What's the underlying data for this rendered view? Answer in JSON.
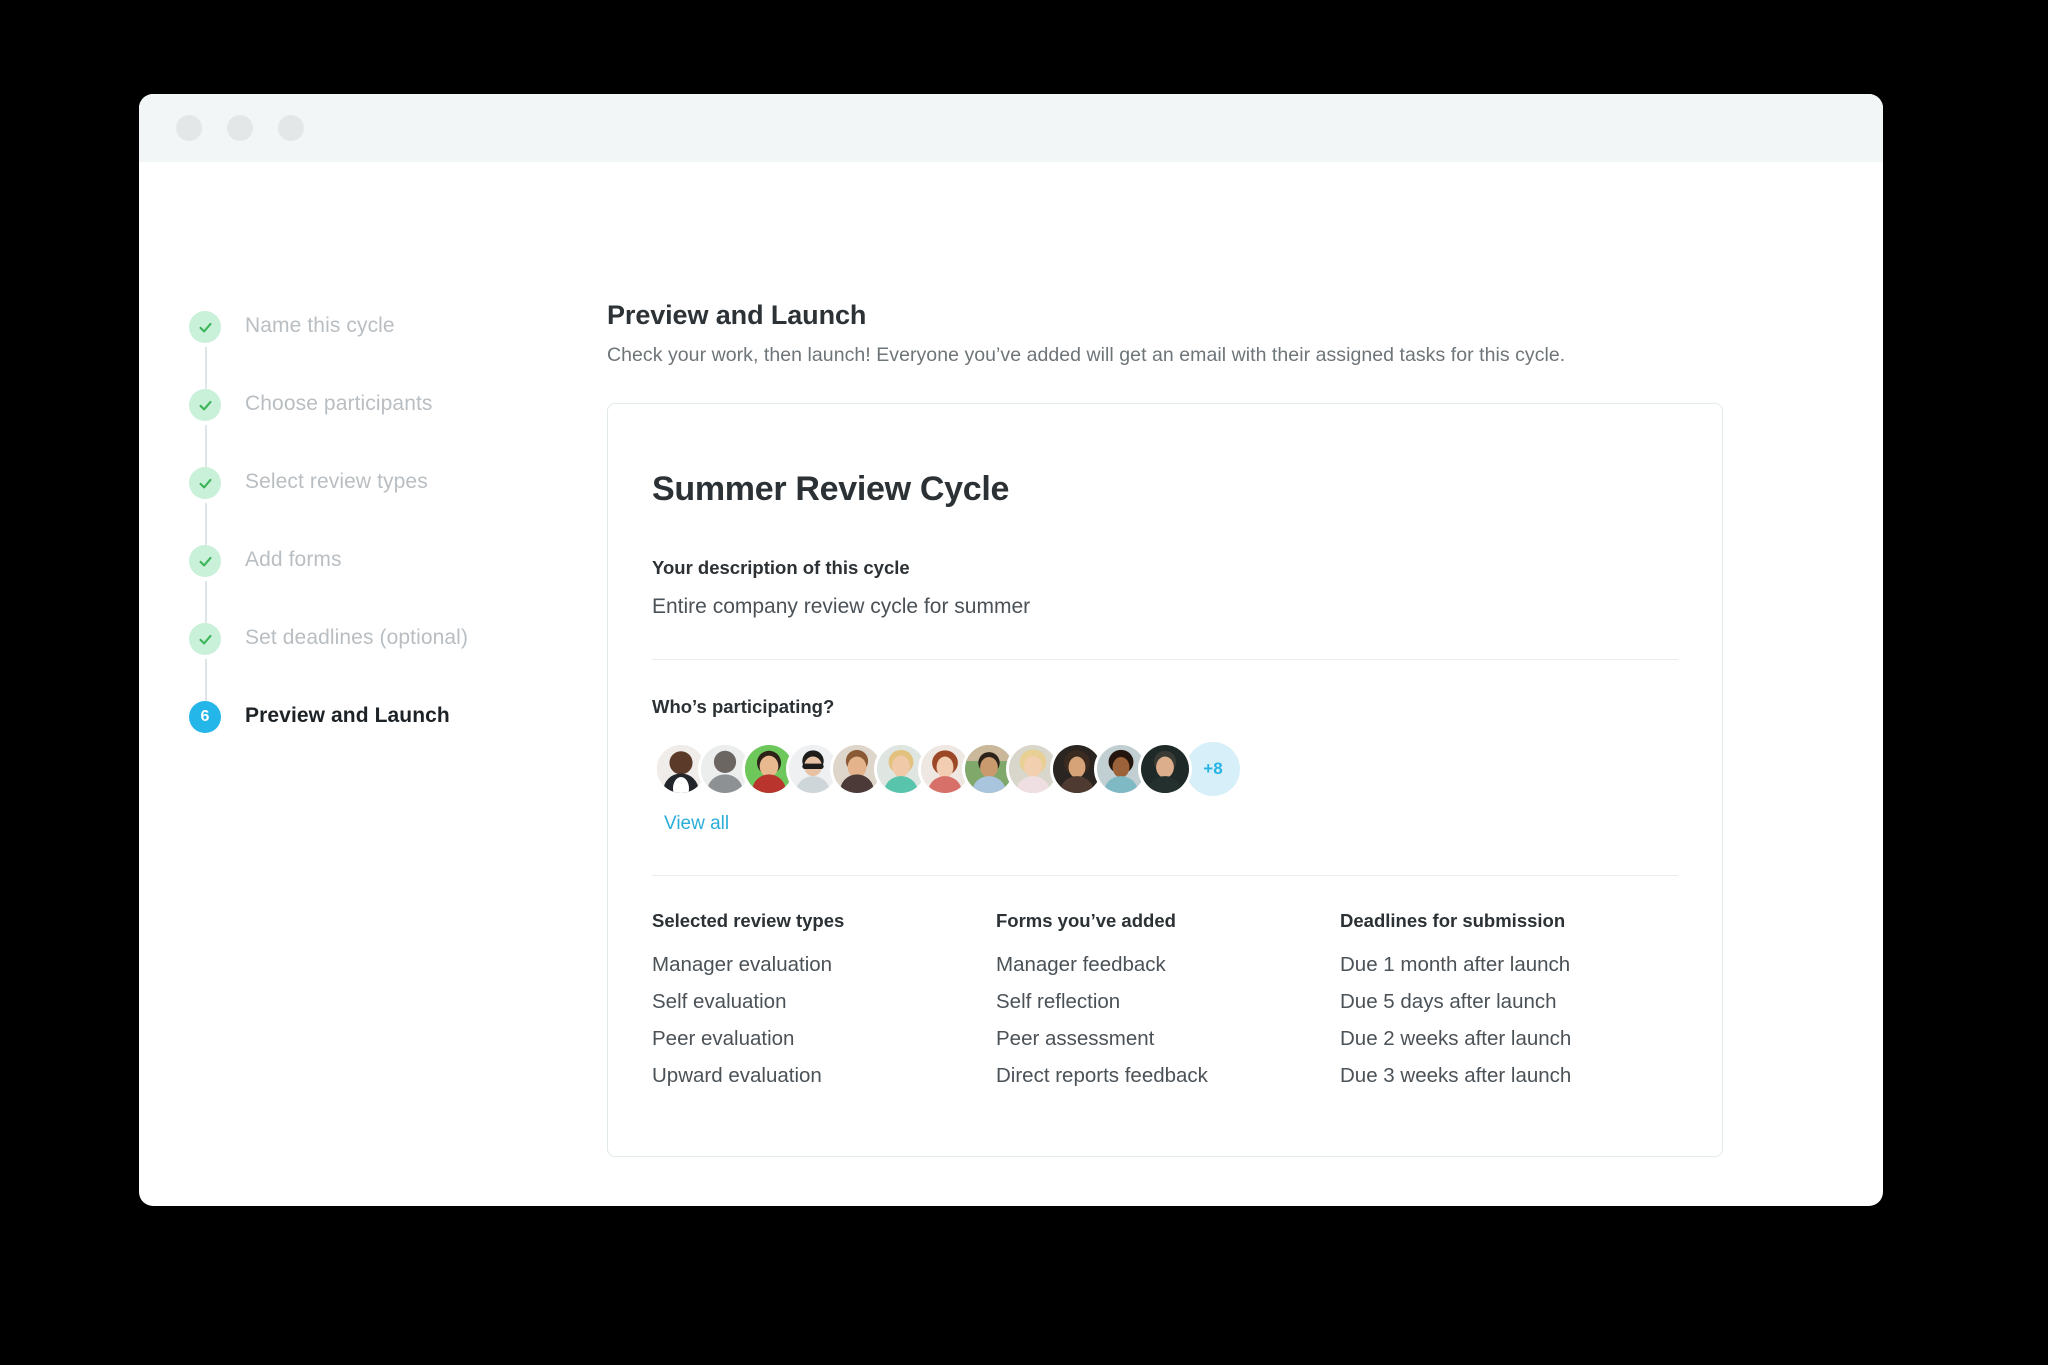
{
  "window": {
    "traffic_lights": [
      "close-dot",
      "minimize-dot",
      "maximize-dot"
    ]
  },
  "stepper": {
    "steps": [
      {
        "label": "Name this cycle",
        "state": "done",
        "marker": "check-icon"
      },
      {
        "label": "Choose participants",
        "state": "done",
        "marker": "check-icon"
      },
      {
        "label": "Select review types",
        "state": "done",
        "marker": "check-icon"
      },
      {
        "label": "Add forms",
        "state": "done",
        "marker": "check-icon"
      },
      {
        "label": "Set deadlines (optional)",
        "state": "done",
        "marker": "check-icon"
      },
      {
        "label": "Preview and Launch",
        "state": "active",
        "marker": "6"
      }
    ]
  },
  "header": {
    "title": "Preview and Launch",
    "subtitle": "Check your work, then launch! Everyone you’ve added will get an email with their assigned tasks for this cycle."
  },
  "card": {
    "cycle_title": "Summer Review Cycle",
    "description_label": "Your description of this cycle",
    "description_value": "Entire company review cycle for summer",
    "participants_label": "Who’s participating?",
    "participants_more": "+8",
    "view_all_label": "View all",
    "avatar_count": 12,
    "columns": [
      {
        "heading": "Selected review types",
        "items": [
          "Manager evaluation",
          "Self evaluation",
          "Peer evaluation",
          "Upward evaluation"
        ]
      },
      {
        "heading": "Forms you’ve added",
        "items": [
          "Manager feedback",
          "Self reflection",
          "Peer assessment",
          "Direct reports feedback"
        ]
      },
      {
        "heading": "Deadlines for submission",
        "items": [
          "Due 1 month after launch",
          "Due 5 days after launch",
          "Due 2 weeks after launch",
          "Due 3 weeks after launch"
        ]
      }
    ]
  },
  "colors": {
    "accent": "#24b6e8",
    "done_circle": "#c9f0d8",
    "check": "#3cb558",
    "link": "#2aadd8",
    "more_badge_bg": "#d7eff9",
    "titlebar": "#f2f6f7"
  }
}
